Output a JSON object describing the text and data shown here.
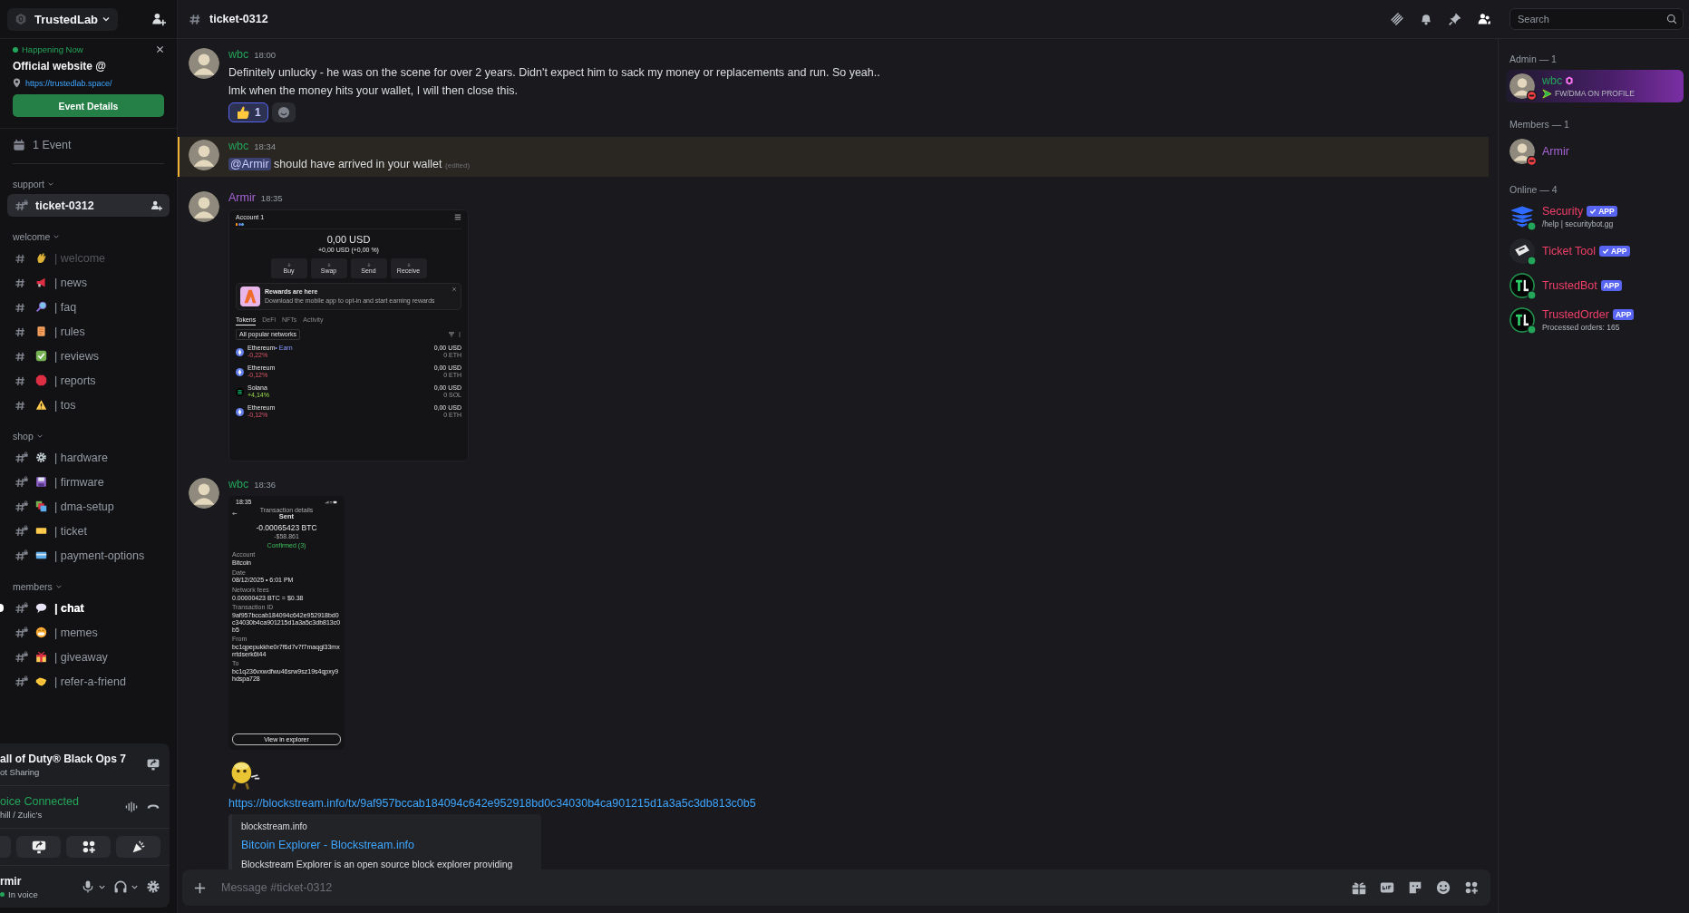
{
  "server": {
    "name": "TrustedLab"
  },
  "event": {
    "status": "Happening Now",
    "title": "Official website @",
    "location": "https://trustedlab.space/",
    "button": "Event Details"
  },
  "event_count": "1 Event",
  "categories": [
    {
      "name": "support",
      "channels": [
        {
          "label": "ticket-0312",
          "kind": "plain",
          "locked": true,
          "selected": true,
          "unread": false,
          "muted": false
        }
      ]
    },
    {
      "name": "welcome",
      "channels": [
        {
          "label": "| welcome",
          "kind": "wave",
          "locked": false,
          "selected": false,
          "unread": false,
          "muted": true
        },
        {
          "label": "| news",
          "kind": "megaphone",
          "locked": false,
          "selected": false,
          "unread": false,
          "muted": false
        },
        {
          "label": "| faq",
          "kind": "magnifier",
          "locked": false,
          "selected": false,
          "unread": false,
          "muted": false
        },
        {
          "label": "| rules",
          "kind": "scroll",
          "locked": false,
          "selected": false,
          "unread": false,
          "muted": false
        },
        {
          "label": "| reviews",
          "kind": "check",
          "locked": false,
          "selected": false,
          "unread": false,
          "muted": false
        },
        {
          "label": "| reports",
          "kind": "stop",
          "locked": false,
          "selected": false,
          "unread": false,
          "muted": false
        },
        {
          "label": "| tos",
          "kind": "warning",
          "locked": false,
          "selected": false,
          "unread": false,
          "muted": false
        }
      ]
    },
    {
      "name": "shop",
      "channels": [
        {
          "label": "| hardware",
          "kind": "gear",
          "locked": true,
          "selected": false,
          "unread": false,
          "muted": false
        },
        {
          "label": "| firmware",
          "kind": "floppy",
          "locked": true,
          "selected": false,
          "unread": false,
          "muted": false
        },
        {
          "label": "| dma-setup",
          "kind": "layers",
          "locked": true,
          "selected": false,
          "unread": false,
          "muted": false
        },
        {
          "label": "| ticket",
          "kind": "ticket",
          "locked": true,
          "selected": false,
          "unread": false,
          "muted": false
        },
        {
          "label": "| payment-options",
          "kind": "card",
          "locked": true,
          "selected": false,
          "unread": false,
          "muted": false
        }
      ]
    },
    {
      "name": "members",
      "channels": [
        {
          "label": "| chat",
          "kind": "speech",
          "locked": true,
          "selected": false,
          "unread": true,
          "muted": false
        },
        {
          "label": "| memes",
          "kind": "grin",
          "locked": true,
          "selected": false,
          "unread": false,
          "muted": false
        },
        {
          "label": "| giveaway",
          "kind": "gift",
          "locked": true,
          "selected": false,
          "unread": false,
          "muted": false
        },
        {
          "label": "| refer-a-friend",
          "kind": "handshake",
          "locked": true,
          "selected": false,
          "unread": false,
          "muted": false
        }
      ]
    }
  ],
  "panel": {
    "activity_title": "all of Duty® Black Ops 7",
    "activity_subtitle": "ot Sharing",
    "voice_status": "oice Connected",
    "voice_channel": "hill / Zulic's",
    "user_name": "rmir",
    "user_status": "In voice"
  },
  "header": {
    "channel": "ticket-0312",
    "search_placeholder": "Search"
  },
  "messages": [
    {
      "kind": "text",
      "author": "wbc",
      "color": "#23a55a",
      "time": "18:00",
      "highlighted": false,
      "lines": [
        "Definitely unlucky - he was on the scene for over 2 years. Didn't expect him to sack my money or replacements and run. So yeah..",
        "lmk when the money hits your wallet, I will then close this."
      ],
      "reactions": [
        {
          "count": "1",
          "selected": true
        }
      ]
    },
    {
      "kind": "mention",
      "author": "wbc",
      "color": "#23a55a",
      "time": "18:34",
      "highlighted": true,
      "mention": "@Armir",
      "text": "should have arrived in your wallet",
      "edited": "(edited)"
    },
    {
      "kind": "wallet",
      "author": "Armir",
      "color": "#a463d4",
      "time": "18:35",
      "highlighted": false,
      "wallet": {
        "account": "Account 1",
        "balance": "0,00 USD",
        "change": "+0,00 USD (+0,00 %)",
        "actions": [
          "Buy",
          "Swap",
          "Send",
          "Receive"
        ],
        "promo_title": "Rewards are here",
        "promo_text": "Download the mobile app to opt-in and start earning rewards",
        "tabs": [
          {
            "label": "Tokens",
            "selected": true
          },
          {
            "label": "DeFi",
            "selected": false
          },
          {
            "label": "NFTs",
            "selected": false
          },
          {
            "label": "Activity",
            "selected": false
          }
        ],
        "filter": "All popular networks",
        "tokens": [
          {
            "name": "Ethereum",
            "extra": "• Earn",
            "change": "-0,22%",
            "positive": false,
            "value": "0,00 USD",
            "amount": "0 ETH",
            "kind": "eth"
          },
          {
            "name": "Ethereum",
            "change": "-0,12%",
            "positive": false,
            "value": "0,00 USD",
            "amount": "0 ETH",
            "kind": "eth"
          },
          {
            "name": "Solana",
            "change": "+4,14%",
            "positive": true,
            "value": "0,00 USD",
            "amount": "0 SOL",
            "kind": "sol"
          },
          {
            "name": "Ethereum",
            "change": "-0,12%",
            "positive": false,
            "value": "0,00 USD",
            "amount": "0 ETH",
            "kind": "eth"
          }
        ]
      }
    },
    {
      "kind": "transaction",
      "author": "wbc",
      "color": "#23a55a",
      "time": "18:36",
      "highlighted": false,
      "transaction": {
        "time": "18:35",
        "header": "Transaction details",
        "title": "Sent",
        "amount": "-0.00065423 BTC",
        "fiat": "-$58.861",
        "status": "Confirmed (3)",
        "fields": [
          {
            "label": "Account",
            "value": "Bitcoin"
          },
          {
            "label": "Date",
            "value": "08/12/2025 • 6:01 PM"
          },
          {
            "label": "Network fees",
            "value": "0.00000423 BTC  =  $0.38"
          },
          {
            "label": "Transaction ID",
            "value": "9af957bccab184094c642e952918bd0c34030b4ca901215d1a3a5c3db813c0b5"
          },
          {
            "label": "From",
            "value": "bc1qpepukkhe0r7f6d7v7f7maqgl33mxrrtdserk6t44"
          },
          {
            "label": "To",
            "value": "bc1q236vxwdfwu46srw9sz19s4qpxy9hdspa728"
          }
        ],
        "button": "View in explorer"
      }
    },
    {
      "kind": "link",
      "highlighted": false,
      "link": "https://blockstream.info/tx/9af957bccab184094c642e952918bd0c34030b4ca901215d1a3a5c3db813c0b5",
      "embed": {
        "provider": "blockstream.info",
        "title": "Bitcoin Explorer - Blockstream.info",
        "description": "Blockstream Explorer is an open source block explorer providing"
      }
    }
  ],
  "composer": {
    "placeholder": "Message #ticket-0312"
  },
  "member_groups": [
    {
      "title": "Admin — 1",
      "members": [
        {
          "name": "wbc",
          "color": "#23a55a",
          "dnd": true,
          "kind": "person",
          "badge": true,
          "banner": true,
          "activity": "FW/DMA ON PROFILE"
        }
      ]
    },
    {
      "title": "Members — 1",
      "members": [
        {
          "name": "Armir",
          "color": "#a463d4",
          "dnd": true,
          "kind": "person",
          "badge": false,
          "banner": false
        }
      ]
    },
    {
      "title": "Online — 4",
      "members": [
        {
          "name": "Security",
          "color": "#f23f6a",
          "dnd": false,
          "kind": "shield",
          "badge": false,
          "banner": false,
          "tag": "APP",
          "verified": true,
          "activity": "/help | securitybot.gg"
        },
        {
          "name": "Ticket Tool",
          "color": "#f23f6a",
          "dnd": false,
          "kind": "ticket",
          "badge": false,
          "banner": false,
          "tag": "APP",
          "verified": true
        },
        {
          "name": "TrustedBot",
          "color": "#f23f6a",
          "dnd": false,
          "kind": "logo",
          "badge": false,
          "banner": false,
          "tag": "APP",
          "verified": false
        },
        {
          "name": "TrustedOrder",
          "color": "#f23f6a",
          "dnd": false,
          "kind": "logo",
          "badge": false,
          "banner": false,
          "tag": "APP",
          "verified": false,
          "activity": "Processed orders: 165"
        }
      ]
    }
  ]
}
